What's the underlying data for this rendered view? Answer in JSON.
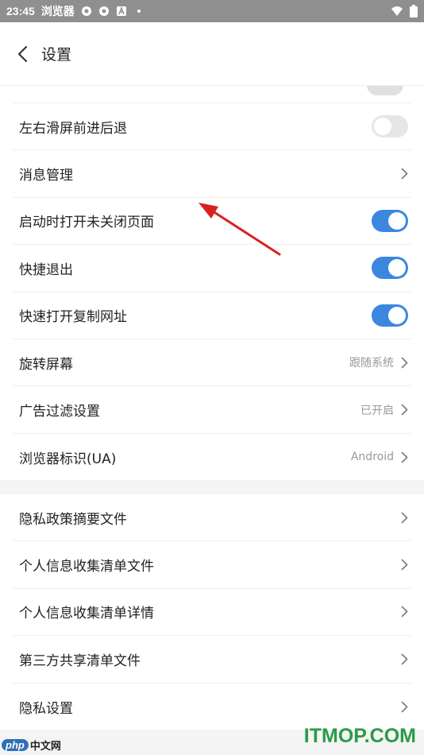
{
  "status_bar": {
    "time": "23:45",
    "app_name": "浏览器",
    "icons": [
      "record-icon",
      "record-icon",
      "a-icon",
      "dot-icon"
    ],
    "right_icons": [
      "wifi-icon",
      "battery-icon"
    ]
  },
  "header": {
    "title": "设置",
    "back_icon": "chevron-left-icon"
  },
  "section1": [
    {
      "label": "左右滑屏前进后退",
      "type": "toggle",
      "on": false
    },
    {
      "label": "消息管理",
      "type": "link"
    },
    {
      "label": "启动时打开未关闭页面",
      "type": "toggle",
      "on": true
    },
    {
      "label": "快捷退出",
      "type": "toggle",
      "on": true
    },
    {
      "label": "快速打开复制网址",
      "type": "toggle",
      "on": true
    },
    {
      "label": "旋转屏幕",
      "type": "link",
      "value": "跟随系统"
    },
    {
      "label": "广告过滤设置",
      "type": "link",
      "value": "已开启"
    },
    {
      "label": "浏览器标识(UA)",
      "type": "link",
      "value": "Android"
    }
  ],
  "section2": [
    {
      "label": "隐私政策摘要文件",
      "type": "link"
    },
    {
      "label": "个人信息收集清单文件",
      "type": "link"
    },
    {
      "label": "个人信息收集清单详情",
      "type": "link"
    },
    {
      "label": "第三方共享清单文件",
      "type": "link"
    },
    {
      "label": "隐私设置",
      "type": "link"
    }
  ],
  "watermarks": {
    "left_badge": "php",
    "left_text": "中文网",
    "right_text": "ITMOP.COM"
  },
  "colors": {
    "toggle_on": "#3b87e0",
    "toggle_off": "#e6e6e6",
    "annotation_arrow": "#d92020",
    "watermark_green": "#2a9b47"
  }
}
